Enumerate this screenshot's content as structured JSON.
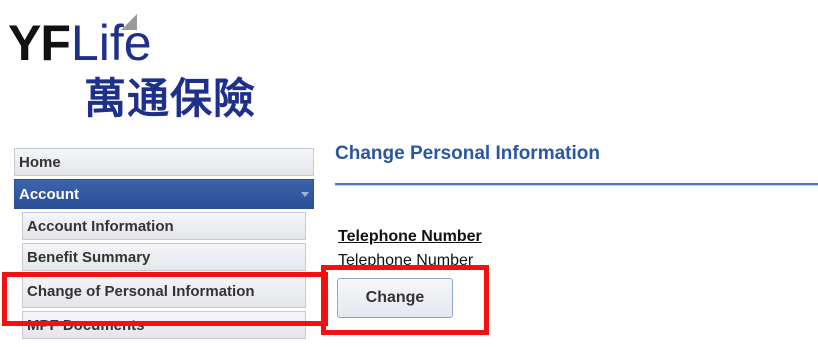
{
  "logo": {
    "en_bold": "YF",
    "en_light": "Life",
    "zh": "萬通保險"
  },
  "sidebar": {
    "items": [
      {
        "label": "Home",
        "active": false
      },
      {
        "label": "Account",
        "active": true
      },
      {
        "label": "Account Information",
        "active": false
      },
      {
        "label": "Benefit Summary",
        "active": false
      },
      {
        "label": "Change of Personal Information",
        "active": false
      },
      {
        "label": "MPF Documents",
        "active": false
      }
    ]
  },
  "main": {
    "title": "Change Personal Information",
    "section_heading": "Telephone Number",
    "field_label": "Telephone Number",
    "change_button": "Change"
  },
  "colors": {
    "accent": "#2a57a0",
    "active_nav": "#2f58a2",
    "highlight": "#f21010"
  }
}
